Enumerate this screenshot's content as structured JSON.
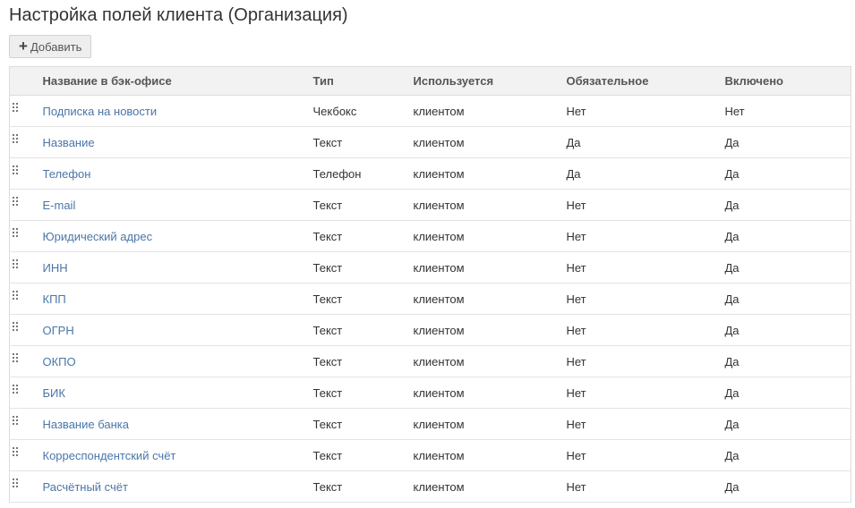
{
  "page": {
    "title": "Настройка полей клиента (Организация)"
  },
  "toolbar": {
    "add_label": "Добавить",
    "add_icon": "plus-icon"
  },
  "icons": {
    "add": "plus-icon",
    "drag": "drag-handle-icon"
  },
  "colors": {
    "link": "#4a76a8",
    "header_bg": "#f2f2f2",
    "border": "#dcdcdc",
    "button_bg": "#eeeeee"
  },
  "table": {
    "columns": [
      "Название в бэк-офисе",
      "Тип",
      "Используется",
      "Обязательное",
      "Включено"
    ],
    "rows": [
      {
        "name": "Подписка на новости",
        "type": "Чекбокс",
        "used_by": "клиентом",
        "required": "Нет",
        "enabled": "Нет"
      },
      {
        "name": "Название",
        "type": "Текст",
        "used_by": "клиентом",
        "required": "Да",
        "enabled": "Да"
      },
      {
        "name": "Телефон",
        "type": "Телефон",
        "used_by": "клиентом",
        "required": "Да",
        "enabled": "Да"
      },
      {
        "name": "E-mail",
        "type": "Текст",
        "used_by": "клиентом",
        "required": "Нет",
        "enabled": "Да"
      },
      {
        "name": "Юридический адрес",
        "type": "Текст",
        "used_by": "клиентом",
        "required": "Нет",
        "enabled": "Да"
      },
      {
        "name": "ИНН",
        "type": "Текст",
        "used_by": "клиентом",
        "required": "Нет",
        "enabled": "Да"
      },
      {
        "name": "КПП",
        "type": "Текст",
        "used_by": "клиентом",
        "required": "Нет",
        "enabled": "Да"
      },
      {
        "name": "ОГРН",
        "type": "Текст",
        "used_by": "клиентом",
        "required": "Нет",
        "enabled": "Да"
      },
      {
        "name": "ОКПО",
        "type": "Текст",
        "used_by": "клиентом",
        "required": "Нет",
        "enabled": "Да"
      },
      {
        "name": "БИК",
        "type": "Текст",
        "used_by": "клиентом",
        "required": "Нет",
        "enabled": "Да"
      },
      {
        "name": "Название банка",
        "type": "Текст",
        "used_by": "клиентом",
        "required": "Нет",
        "enabled": "Да"
      },
      {
        "name": "Корреспондентский счёт",
        "type": "Текст",
        "used_by": "клиентом",
        "required": "Нет",
        "enabled": "Да"
      },
      {
        "name": "Расчётный счёт",
        "type": "Текст",
        "used_by": "клиентом",
        "required": "Нет",
        "enabled": "Да"
      }
    ]
  }
}
